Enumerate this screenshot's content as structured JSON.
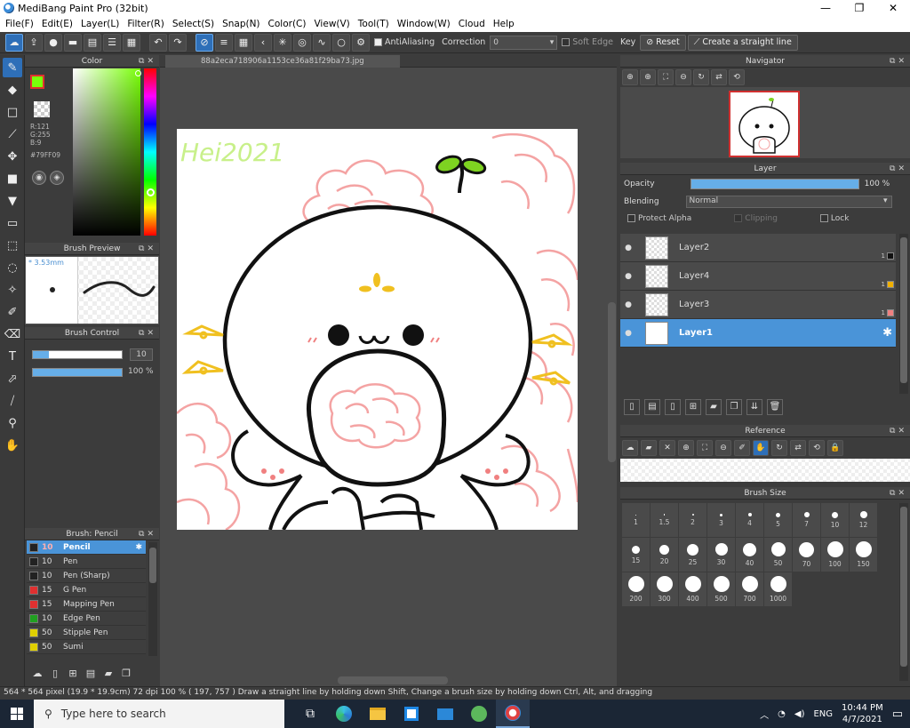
{
  "window": {
    "title": "MediBang Paint Pro (32bit)",
    "controls": [
      "—",
      "❐",
      "✕"
    ]
  },
  "menu": [
    "File(F)",
    "Edit(E)",
    "Layer(L)",
    "Filter(R)",
    "Select(S)",
    "Snap(N)",
    "Color(C)",
    "View(V)",
    "Tool(T)",
    "Window(W)",
    "Cloud",
    "Help"
  ],
  "toolbar": {
    "antialiasing_label": "AntiAliasing",
    "correction_label": "Correction",
    "correction_value": "0",
    "soft_edge_label": "Soft Edge",
    "key_label": "Key",
    "reset_label": "Reset",
    "straight_line_label": "Create a straight line"
  },
  "color_panel": {
    "title": "Color",
    "r": "R:121",
    "g": "G:255",
    "b": "B:9",
    "hex": "#79FF09",
    "current_color": "#79ff09"
  },
  "brush_preview": {
    "title": "Brush Preview",
    "size": "3.53mm"
  },
  "brush_control": {
    "title": "Brush Control",
    "size_value": "10",
    "opacity_value": "100 %",
    "size_fraction": 0.1,
    "opacity_fraction": 1.0
  },
  "brush_list": {
    "title": "Brush: Pencil",
    "items": [
      {
        "size": "10",
        "name": "Pencil",
        "color": "#222222"
      },
      {
        "size": "10",
        "name": "Pen",
        "color": "#222222"
      },
      {
        "size": "10",
        "name": "Pen (Sharp)",
        "color": "#222222"
      },
      {
        "size": "15",
        "name": "G Pen",
        "color": "#e03030"
      },
      {
        "size": "15",
        "name": "Mapping Pen",
        "color": "#e03030"
      },
      {
        "size": "10",
        "name": "Edge Pen",
        "color": "#20a020"
      },
      {
        "size": "50",
        "name": "Stipple Pen",
        "color": "#e0d000"
      },
      {
        "size": "50",
        "name": "Sumi",
        "color": "#e0d000"
      }
    ]
  },
  "canvas": {
    "filename": "88a2eca718906a1153ce36a81f29ba73.jpg",
    "handwriting": "Hei2021"
  },
  "navigator": {
    "title": "Navigator"
  },
  "layer_panel": {
    "title": "Layer",
    "opacity_label": "Opacity",
    "opacity_value": "100 %",
    "blending_label": "Blending",
    "blending_value": "Normal",
    "protect_alpha": "Protect Alpha",
    "clipping": "Clipping",
    "lock": "Lock",
    "layers": [
      {
        "name": "Layer2",
        "badge_num": "1",
        "badge_color": "#111111"
      },
      {
        "name": "Layer4",
        "badge_num": "1",
        "badge_color": "#f0b000"
      },
      {
        "name": "Layer3",
        "badge_num": "1",
        "badge_color": "#f08080"
      },
      {
        "name": "Layer1",
        "badge_num": "",
        "badge_color": ""
      }
    ]
  },
  "reference": {
    "title": "Reference"
  },
  "brush_size": {
    "title": "Brush Size",
    "sizes": [
      "1",
      "1.5",
      "2",
      "3",
      "4",
      "5",
      "7",
      "10",
      "12",
      "15",
      "20",
      "25",
      "30",
      "40",
      "50",
      "70",
      "100",
      "150",
      "200",
      "300",
      "400",
      "500",
      "700",
      "1000"
    ]
  },
  "status": {
    "text": "564 * 564 pixel  (19.9 * 19.9cm)  72 dpi  100 %  ( 197, 757 )  Draw a straight line by holding down Shift, Change a brush size by holding down Ctrl, Alt, and dragging"
  },
  "taskbar": {
    "search_placeholder": "Type here to search",
    "language": "ENG",
    "time": "10:44 PM",
    "date": "4/7/2021"
  }
}
